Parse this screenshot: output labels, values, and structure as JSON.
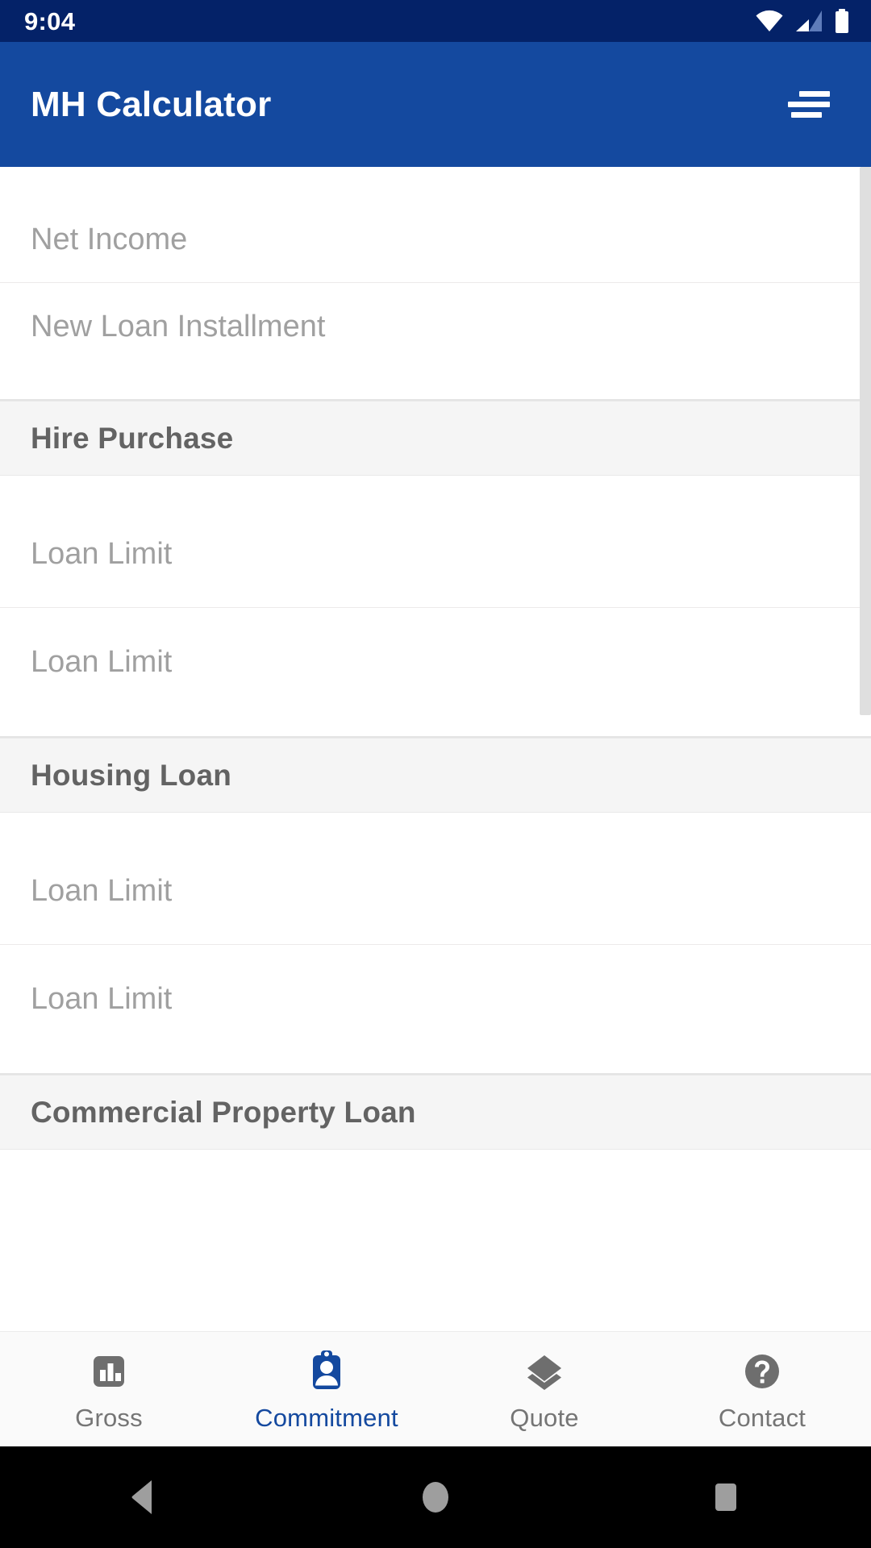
{
  "status_bar": {
    "time": "9:04",
    "icons": [
      "wifi-icon",
      "cellular-signal-icon",
      "battery-icon"
    ],
    "background_color": "#042268"
  },
  "app_bar": {
    "title": "MH Calculator",
    "menu_icon": "hamburger-menu-icon",
    "background_color": "#14499f",
    "text_color": "#ffffff"
  },
  "content": {
    "groups": [
      {
        "type": "fields",
        "rows": [
          {
            "placeholder": "Net Income",
            "value": ""
          },
          {
            "placeholder": "New Loan Installment",
            "value": ""
          }
        ]
      },
      {
        "type": "section",
        "title": "Hire Purchase"
      },
      {
        "type": "fields",
        "rows": [
          {
            "placeholder": "Loan Limit",
            "value": ""
          },
          {
            "placeholder": "Loan Limit",
            "value": ""
          }
        ]
      },
      {
        "type": "section",
        "title": "Housing Loan"
      },
      {
        "type": "fields",
        "rows": [
          {
            "placeholder": "Loan Limit",
            "value": ""
          },
          {
            "placeholder": "Loan Limit",
            "value": ""
          }
        ]
      },
      {
        "type": "section",
        "title": "Commercial Property Loan"
      }
    ],
    "field_placeholder_color": "#a0a0a0",
    "section_header_color": "#636363",
    "section_header_background": "#f5f5f5",
    "scrollbar": {
      "visible": true,
      "thumb_color": "#dfdfdf"
    }
  },
  "bottom_nav": {
    "active_index": 1,
    "active_color": "#14499f",
    "inactive_color": "#757575",
    "items": [
      {
        "label": "Gross",
        "icon": "bar-chart-icon"
      },
      {
        "label": "Commitment",
        "icon": "id-badge-person-icon"
      },
      {
        "label": "Quote",
        "icon": "layers-icon"
      },
      {
        "label": "Contact",
        "icon": "help-question-circle-icon"
      }
    ]
  },
  "system_nav": {
    "buttons": [
      {
        "name": "back",
        "icon": "triangle-back-icon"
      },
      {
        "name": "home",
        "icon": "circle-home-icon"
      },
      {
        "name": "recents",
        "icon": "square-recents-icon"
      }
    ],
    "background_color": "#000000",
    "icon_color": "#9e9e9e"
  }
}
